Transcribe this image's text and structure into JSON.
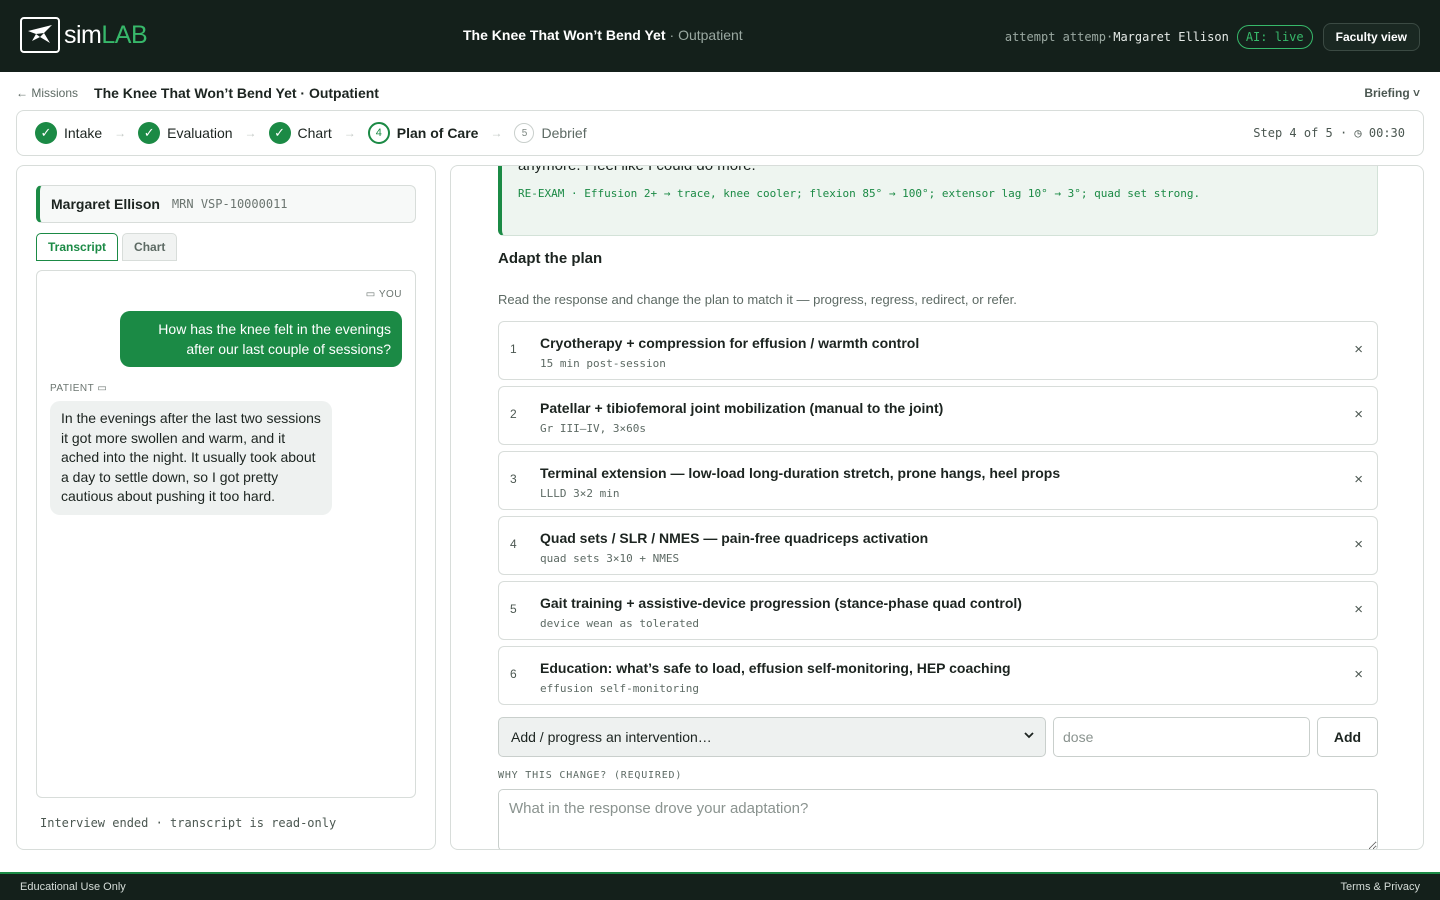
{
  "header": {
    "logo_prefix": "sim",
    "logo_suffix": "LAB",
    "case_title": "The Knee That Won’t Bend Yet",
    "case_setting": "· Outpatient",
    "attempt_text": "attempt attemp·",
    "attempt_name": "Margaret Ellison",
    "ai_badge": "AI: live",
    "faculty_button": "Faculty view"
  },
  "breadcrumb": {
    "back": "← Missions",
    "title": "The Knee That Won’t Bend Yet · Outpatient",
    "briefing": "Briefing ˅"
  },
  "stepper": {
    "steps": [
      {
        "num": "1",
        "label": "Intake",
        "state": "done"
      },
      {
        "num": "2",
        "label": "Evaluation",
        "state": "done"
      },
      {
        "num": "3",
        "label": "Chart",
        "state": "done"
      },
      {
        "num": "4",
        "label": "Plan of Care",
        "state": "active"
      },
      {
        "num": "5",
        "label": "Debrief",
        "state": "idle"
      }
    ],
    "check_glyph": "✓",
    "arrow_glyph": "→",
    "progress": "Step 4 of 5 · ◷ 00:30"
  },
  "patient": {
    "name": "Margaret Ellison",
    "mrn": "MRN VSP-10000011"
  },
  "tabs": {
    "transcript": "Transcript",
    "chart": "Chart"
  },
  "transcript": {
    "you_label": "▭ YOU",
    "you_message": "How has the knee felt in the evenings after our last couple of sessions?",
    "patient_label": "PATIENT ▭",
    "patient_message": "In the evenings after the last two sessions it got more swollen and warm, and it ached into the night. It usually took about a day to settle down, so I got pretty cautious about pushing it too hard.",
    "ended_note": "Interview ended · transcript is read-only"
  },
  "reexam": {
    "quote_tail": "anymore. I feel like I could do more.”",
    "line": "RE-EXAM · Effusion 2+ → trace, knee cooler; flexion 85° → 100°; extensor lag 10° → 3°; quad set strong."
  },
  "plan": {
    "title": "Adapt the plan",
    "subtitle": "Read the response and change the plan to match it — progress, regress, redirect, or refer.",
    "remove_glyph": "×",
    "items": [
      {
        "num": "1",
        "name": "Cryotherapy + compression for effusion / warmth control",
        "dose": "15 min post-session"
      },
      {
        "num": "2",
        "name": "Patellar + tibiofemoral joint mobilization (manual to the joint)",
        "dose": "Gr III–IV, 3×60s"
      },
      {
        "num": "3",
        "name": "Terminal extension — low-load long-duration stretch, prone hangs, heel props",
        "dose": "LLLD 3×2 min"
      },
      {
        "num": "4",
        "name": "Quad sets / SLR / NMES — pain-free quadriceps activation",
        "dose": "quad sets 3×10 + NMES"
      },
      {
        "num": "5",
        "name": "Gait training + assistive-device progression (stance-phase quad control)",
        "dose": "device wean as tolerated"
      },
      {
        "num": "6",
        "name": "Education: what’s safe to load, effusion self-monitoring, HEP coaching",
        "dose": "effusion self-monitoring"
      }
    ],
    "select_value": "Add / progress an intervention…",
    "dose_placeholder": "dose",
    "add_button": "Add",
    "why_label": "WHY THIS CHANGE? (REQUIRED)",
    "why_placeholder": "What in the response drove your adaptation?"
  },
  "footer": {
    "left": "Educational Use Only",
    "right": "Terms & Privacy"
  }
}
